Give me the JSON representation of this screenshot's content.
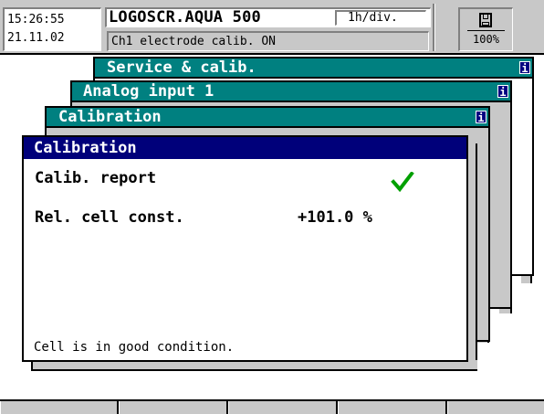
{
  "header": {
    "time": "15:26:55",
    "date": "21.11.02",
    "instrument": "LOGOSCR.AQUA 500",
    "div_setting": "1h/div.",
    "status": "Ch1 electrode calib. ON",
    "memory_percent": "100%",
    "memory_icon": "memory-card-icon"
  },
  "menus": [
    {
      "title": "Service & calib.",
      "icon": "info-icon"
    },
    {
      "title": "Analog input 1",
      "icon": "info-icon"
    },
    {
      "title": "Calibration",
      "icon": "info-icon"
    }
  ],
  "dialog": {
    "title": "Calibration",
    "report_label": "Calib. report",
    "report_status_icon": "green-checkmark-icon",
    "cell_const_label": "Rel. cell const.",
    "cell_const_value": "+101.0 %",
    "message": "Cell is in good condition."
  },
  "softkeys": [
    "",
    "",
    "",
    "",
    ""
  ],
  "colors": {
    "menu_title_bg": "#008080",
    "dialog_title_bg": "#00007A",
    "check_green": "#00A000",
    "frame_gray": "#C8C8C8"
  }
}
